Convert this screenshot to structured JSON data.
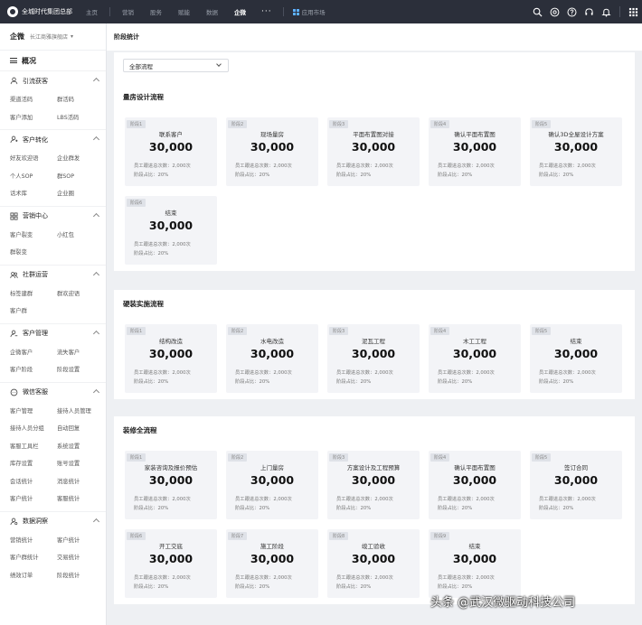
{
  "topbar": {
    "brand": "全城时代集团总部",
    "nav": [
      "主页",
      "营销",
      "股务",
      "赋能",
      "数据",
      "企微"
    ],
    "active_index": 5,
    "more": "···",
    "app_market": "应用市场",
    "icons": [
      "search-icon",
      "settings-icon",
      "help-icon",
      "headset-icon",
      "bell-icon",
      "apps-grid-icon"
    ]
  },
  "sidebar": {
    "title": "企微",
    "store": "长江商雅旗舰店",
    "overview": "概况",
    "groups": [
      {
        "title": "引流获客",
        "icon": "user-icon",
        "items": [
          "渠道活码",
          "群活码",
          "客户添加",
          "LBS活码"
        ]
      },
      {
        "title": "客户转化",
        "icon": "user-convert-icon",
        "items": [
          "好友欢迎语",
          "企业群发",
          "个人SOP",
          "群SOP",
          "话术库",
          "企业圈"
        ]
      },
      {
        "title": "营销中心",
        "icon": "grid-icon",
        "items": [
          "客户裂变",
          "小红包",
          "群裂变"
        ]
      },
      {
        "title": "社群运营",
        "icon": "group-icon",
        "items": [
          "标签建群",
          "群欢迎语",
          "客户群"
        ]
      },
      {
        "title": "客户管理",
        "icon": "customer-icon",
        "items": [
          "企微客户",
          "流失客户",
          "客户阶段",
          "阶段设置"
        ]
      },
      {
        "title": "微信客服",
        "icon": "service-icon",
        "items": [
          "客户管理",
          "接待人员管理",
          "接待人员分组",
          "自动回复",
          "客服工具栏",
          "系统设置",
          "库存设置",
          "账号设置",
          "会话统计",
          "消息统计",
          "客户统计",
          "客服统计"
        ]
      },
      {
        "title": "数据洞察",
        "icon": "data-icon",
        "items": [
          "营销统计",
          "客户统计",
          "客户群统计",
          "交易统计",
          "绩效订单",
          "阶段统计"
        ]
      }
    ]
  },
  "main": {
    "page_title": "阶段统计",
    "filter": {
      "value": "全部流程"
    },
    "sections": [
      {
        "title": "量房设计流程",
        "cards": [
          {
            "tag": "阶段1",
            "name": "联系客户",
            "value": "30,000",
            "line1": "员工跟进总次数：2,000次",
            "line2": "阶段占比：20%"
          },
          {
            "tag": "阶段2",
            "name": "现场量房",
            "value": "30,000",
            "line1": "员工跟进总次数：2,000次",
            "line2": "阶段占比：20%"
          },
          {
            "tag": "阶段3",
            "name": "平面布置图对接",
            "value": "30,000",
            "line1": "员工跟进总次数：2,000次",
            "line2": "阶段占比：20%"
          },
          {
            "tag": "阶段4",
            "name": "确认平面布置图",
            "value": "30,000",
            "line1": "员工跟进总次数：2,000次",
            "line2": "阶段占比：20%"
          },
          {
            "tag": "阶段5",
            "name": "确认3D全屋设计方案",
            "value": "30,000",
            "line1": "员工跟进总次数：2,000次",
            "line2": "阶段占比：20%"
          },
          {
            "tag": "阶段6",
            "name": "结束",
            "value": "30,000",
            "line1": "员工跟进总次数：2,000次",
            "line2": "阶段占比：20%"
          }
        ]
      },
      {
        "title": "硬装实施流程",
        "cards": [
          {
            "tag": "阶段1",
            "name": "结构改造",
            "value": "30,000",
            "line1": "员工跟进总次数：2,000次",
            "line2": "阶段占比：20%"
          },
          {
            "tag": "阶段2",
            "name": "水电改造",
            "value": "30,000",
            "line1": "员工跟进总次数：2,000次",
            "line2": "阶段占比：20%"
          },
          {
            "tag": "阶段3",
            "name": "泥瓦工程",
            "value": "30,000",
            "line1": "员工跟进总次数：2,000次",
            "line2": "阶段占比：20%"
          },
          {
            "tag": "阶段4",
            "name": "木工工程",
            "value": "30,000",
            "line1": "员工跟进总次数：2,000次",
            "line2": "阶段占比：20%"
          },
          {
            "tag": "阶段5",
            "name": "结束",
            "value": "30,000",
            "line1": "员工跟进总次数：2,000次",
            "line2": "阶段占比：20%"
          }
        ]
      },
      {
        "title": "装修全流程",
        "cards": [
          {
            "tag": "阶段1",
            "name": "家装咨询及报价预估",
            "value": "30,000",
            "line1": "员工跟进总次数：2,000次",
            "line2": "阶段占比：20%"
          },
          {
            "tag": "阶段2",
            "name": "上门量房",
            "value": "30,000",
            "line1": "员工跟进总次数：2,000次",
            "line2": "阶段占比：20%"
          },
          {
            "tag": "阶段3",
            "name": "方案设计及工程预算",
            "value": "30,000",
            "line1": "员工跟进总次数：2,000次",
            "line2": "阶段占比：20%"
          },
          {
            "tag": "阶段4",
            "name": "确认平面布置图",
            "value": "30,000",
            "line1": "员工跟进总次数：2,000次",
            "line2": "阶段占比：20%"
          },
          {
            "tag": "阶段5",
            "name": "签订合同",
            "value": "30,000",
            "line1": "员工跟进总次数：2,000次",
            "line2": "阶段占比：20%"
          },
          {
            "tag": "阶段6",
            "name": "开工交底",
            "value": "30,000",
            "line1": "员工跟进总次数：2,000次",
            "line2": "阶段占比：20%"
          },
          {
            "tag": "阶段7",
            "name": "施工阶段",
            "value": "30,000",
            "line1": "员工跟进总次数：2,000次",
            "line2": "阶段占比：20%"
          },
          {
            "tag": "阶段8",
            "name": "竣工验收",
            "value": "30,000",
            "line1": "员工跟进总次数：2,000次",
            "line2": "阶段占比：20%"
          },
          {
            "tag": "阶段9",
            "name": "结束",
            "value": "30,000",
            "line1": "员工跟进总次数：2,000次",
            "line2": "阶段占比：20%"
          }
        ]
      }
    ]
  },
  "watermark": "头条 @武汉微驱动科技公司"
}
